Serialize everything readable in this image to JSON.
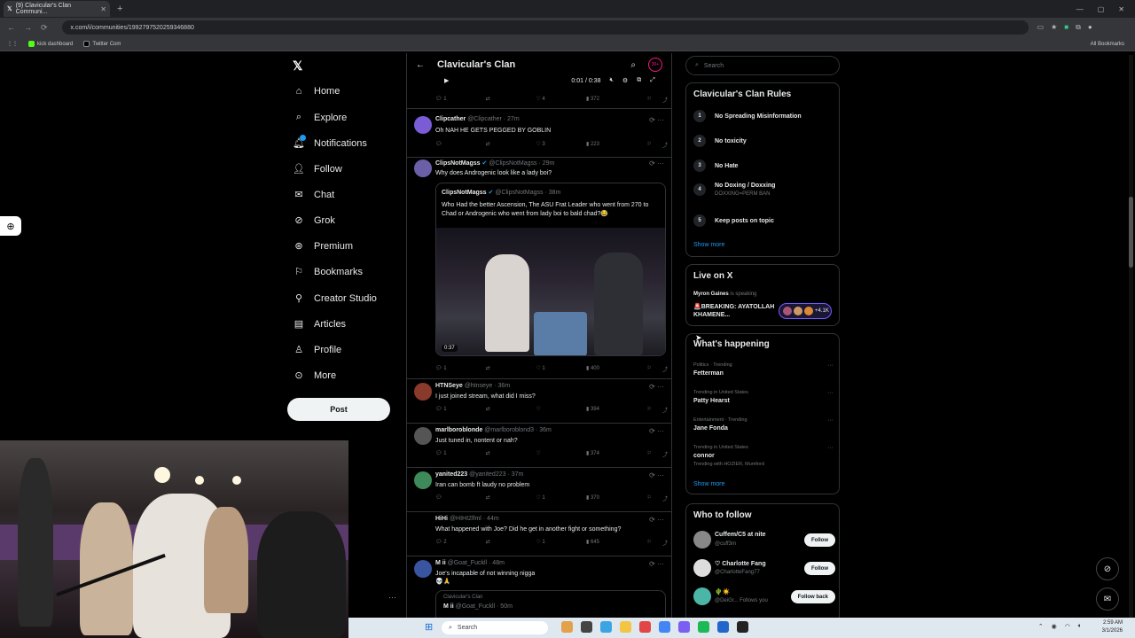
{
  "browser": {
    "tab_title": "(9) Clavicular's Clan Communi...",
    "url": "x.com/i/communities/1992797520259346880",
    "bookmarks": [
      "kick dashboard",
      "Twitter Com"
    ],
    "all_bookmarks": "All Bookmarks"
  },
  "nav": {
    "items": [
      "Home",
      "Explore",
      "Notifications",
      "Follow",
      "Chat",
      "Grok",
      "Premium",
      "Bookmarks",
      "Creator Studio",
      "Articles",
      "Profile",
      "More"
    ],
    "post_label": "Post"
  },
  "feed": {
    "title": "Clavicular's Clan",
    "badge": "30+",
    "video_time": "0:01 / 0:38",
    "top_actions": {
      "replies": "1",
      "likes": "4",
      "views": "372"
    },
    "tweets": [
      {
        "name": "Clipcather",
        "handle": "@Clipcather · 27m",
        "text": "Oh NAH HE GETS PEGGED BY GOBLIN",
        "replies": "",
        "likes": "3",
        "views": "223"
      },
      {
        "name": "ClipsNotMagss",
        "handle": "@ClipsNotMagss · 29m",
        "text": "Why does Androgenic look like a lady boi?",
        "replies": "1",
        "likes": "1",
        "views": "400",
        "quote": {
          "name": "ClipsNotMagss",
          "handle": "@ClipsNotMagss · 38m",
          "text": "Who Had the better Ascension, The ASU Frat Leader who went from 270 to Chad or Androgenic who went from lady boi to bald chad?😂",
          "duration": "0:37"
        }
      },
      {
        "name": "HTNSeye",
        "handle": "@htnseye · 36m",
        "text": "I just joined stream, what did I miss?",
        "replies": "1",
        "likes": "",
        "views": "394"
      },
      {
        "name": "marlboroblonde",
        "handle": "@marlboroblond3 · 36m",
        "text": "Just tuned in, nontent or nah?",
        "replies": "1",
        "likes": "",
        "views": "374"
      },
      {
        "name": "yanited223",
        "handle": "@yanited223 · 37m",
        "text": "Iran can bomb ft laudy no problem",
        "replies": "",
        "likes": "1",
        "views": "370"
      },
      {
        "name": "HiHi",
        "handle": "@HIHI2lfml · 44m",
        "text": "What happened with Joe? Did he get in another fight or something?",
        "replies": "2",
        "likes": "1",
        "views": "645"
      },
      {
        "name": "M ii",
        "handle": "@Goat_Fuckll · 48m",
        "text": "Joe's incapable of not winning nigga",
        "replies": "",
        "likes": "",
        "views": ""
      }
    ],
    "last_quote": {
      "community": "Clavicular's Clan",
      "name": "M ii",
      "handle": "@Goat_Fuckll · 50m"
    }
  },
  "right": {
    "search_placeholder": "Search",
    "rules_title": "Clavicular's Clan Rules",
    "rules": [
      {
        "n": "1",
        "text": "No Spreading Misinformation",
        "sub": ""
      },
      {
        "n": "2",
        "text": "No toxicity",
        "sub": ""
      },
      {
        "n": "3",
        "text": "No Hate",
        "sub": ""
      },
      {
        "n": "4",
        "text": "No Doxing / Doxxing",
        "sub": "DOXXING=PERM BAN"
      },
      {
        "n": "5",
        "text": "Keep posts on topic",
        "sub": ""
      }
    ],
    "show_more": "Show more",
    "live_title": "Live on X",
    "live_host": "Myron Gaines",
    "live_status": "is speaking",
    "live_text": "🚨BREAKING: AYATOLLAH KHAMENE...",
    "live_count": "+4.1K",
    "happening_title": "What's happening",
    "trends": [
      {
        "cat": "Politics · Trending",
        "name": "Fetterman",
        "extra": ""
      },
      {
        "cat": "Trending in United States",
        "name": "Patty Hearst",
        "extra": ""
      },
      {
        "cat": "Entertainment · Trending",
        "name": "Jane Fonda",
        "extra": ""
      },
      {
        "cat": "Trending in United States",
        "name": "connor",
        "extra": "Trending with HOZIER, Mumford"
      }
    ],
    "wtf_title": "Who to follow",
    "wtf": [
      {
        "name": "Cuffem/C5 at nite",
        "handle": "@cuff3m",
        "btn": "Follow"
      },
      {
        "name": "♡ Charlotte Fang",
        "handle": "@CharlotteFang77",
        "btn": "Follow"
      },
      {
        "name": "🌵☀️",
        "handle": "@DeiGr...  Follows you",
        "btn": "Follow back"
      }
    ]
  },
  "taskbar": {
    "search": "Search",
    "time": "2:59 AM",
    "date": "3/1/2026"
  }
}
